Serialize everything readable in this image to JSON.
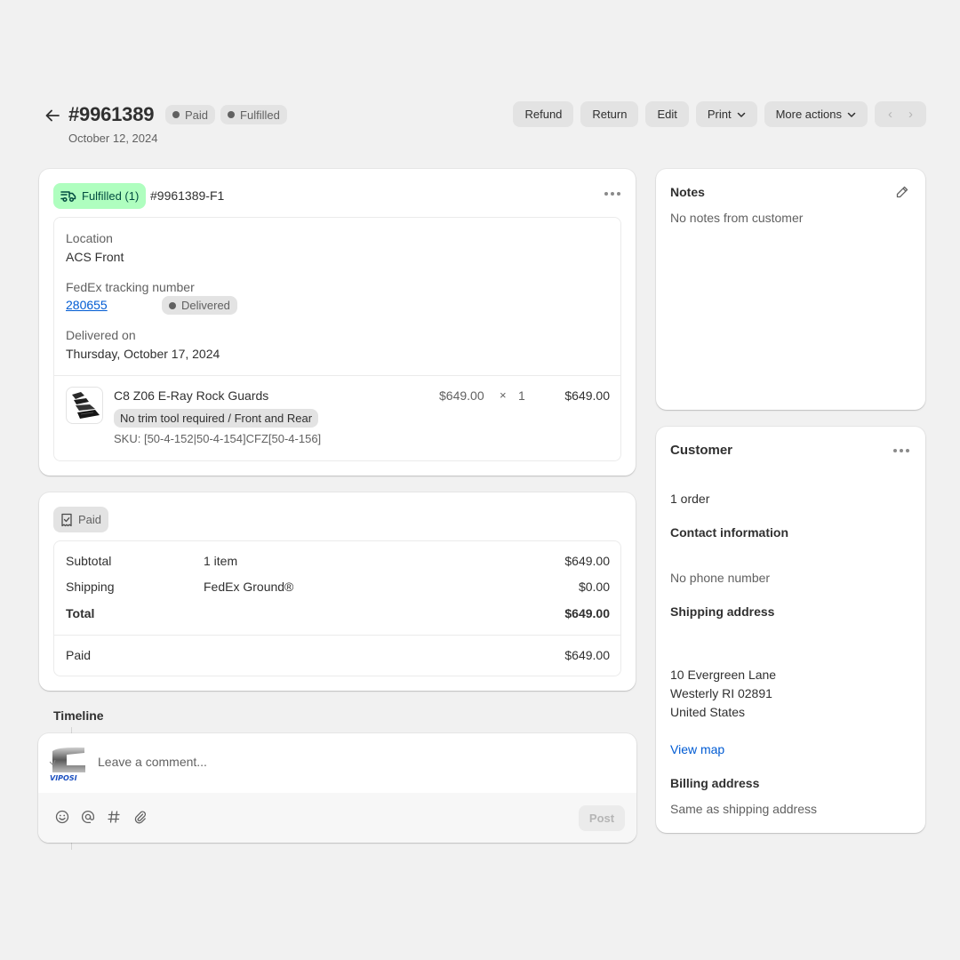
{
  "header": {
    "order_number": "#9961389",
    "date": "October 12, 2024",
    "badges": [
      {
        "label": "Paid"
      },
      {
        "label": "Fulfilled"
      }
    ],
    "actions": {
      "refund": "Refund",
      "return": "Return",
      "edit": "Edit",
      "print": "Print",
      "more_actions": "More actions"
    },
    "pager": {
      "prev": "‹",
      "next": "›"
    }
  },
  "fulfillment": {
    "status_label": "Fulfilled (1)",
    "fulfillment_id": "#9961389-F1",
    "location_label": "Location",
    "location_value": "ACS Front",
    "tracking_label": "FedEx tracking number",
    "tracking_number": "280655",
    "tracking_status": "Delivered",
    "delivered_label": "Delivered on",
    "delivered_value": "Thursday, October 17, 2024",
    "line_item": {
      "name": "C8 Z06 E-Ray Rock Guards",
      "variant": "No trim tool required / Front and Rear",
      "sku": "SKU: [50-4-152|50-4-154]CFZ[50-4-156]",
      "unit_price": "$649.00",
      "times": "×",
      "quantity": "1",
      "total": "$649.00"
    }
  },
  "payment": {
    "status_label": "Paid",
    "rows": [
      {
        "label": "Subtotal",
        "detail": "1 item",
        "amount": "$649.00"
      },
      {
        "label": "Shipping",
        "detail": "FedEx Ground®",
        "amount": "$0.00"
      },
      {
        "label": "Total",
        "detail": "",
        "amount": "$649.00"
      }
    ],
    "paid_label": "Paid",
    "paid_amount": "$649.00"
  },
  "timeline": {
    "title": "Timeline",
    "comment_placeholder": "Leave a comment...",
    "post_label": "Post",
    "avatar_text": "VIPOSI"
  },
  "notes": {
    "title": "Notes",
    "empty_text": "No notes from customer"
  },
  "customer": {
    "title": "Customer",
    "orders": "1 order",
    "contact_heading": "Contact information",
    "phone": "No phone number",
    "shipping_heading": "Shipping address",
    "address_lines": [
      "10 Evergreen Lane",
      "Westerly RI 02891",
      "United States"
    ],
    "view_map": "View map",
    "billing_heading": "Billing address",
    "billing_text": "Same as shipping address"
  },
  "colors": {
    "fulfilled_bg": "#affebf",
    "fulfilled_text": "#014b40",
    "link": "#005bd3",
    "page_bg": "#f1f1f1"
  }
}
